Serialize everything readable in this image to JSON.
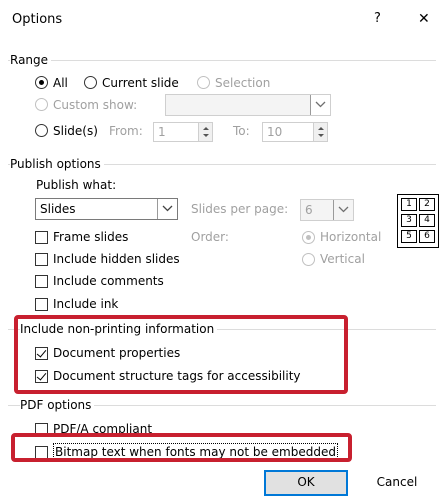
{
  "title_bar": {
    "title": "Options",
    "help_label": "?",
    "close_label": "✕"
  },
  "range": {
    "title": "Range",
    "all_label": "All",
    "current_slide_label": "Current slide",
    "selection_label": "Selection",
    "custom_show_label": "Custom show:",
    "custom_show_value": "",
    "slides_label": "Slide(s)",
    "from_label": "From:",
    "from_value": "1",
    "to_label": "To:",
    "to_value": "10"
  },
  "publish": {
    "title": "Publish options",
    "publish_what_label": "Publish what:",
    "publish_what_value": "Slides",
    "slides_per_page_label": "Slides per page:",
    "slides_per_page_value": "6",
    "order_label": "Order:",
    "horizontal_label": "Horizontal",
    "vertical_label": "Vertical",
    "frame_slides_label": "Frame slides",
    "include_hidden_label": "Include hidden slides",
    "include_comments_label": "Include comments",
    "include_ink_label": "Include ink",
    "preview_numbers": [
      "1",
      "2",
      "3",
      "4",
      "5",
      "6"
    ]
  },
  "nonprinting": {
    "title": "Include non-printing information",
    "document_properties_label": "Document properties",
    "document_properties_checked": true,
    "structure_tags_label": "Document structure tags for accessibility",
    "structure_tags_checked": true
  },
  "pdf": {
    "title": "PDF options",
    "pdfa_label": "PDF/A compliant",
    "bitmap_label": "Bitmap text when fonts may not be embedded"
  },
  "buttons": {
    "ok_label": "OK",
    "cancel_label": "Cancel"
  },
  "colors": {
    "highlight": "#c8202f",
    "default_button_border": "#0078d7"
  }
}
